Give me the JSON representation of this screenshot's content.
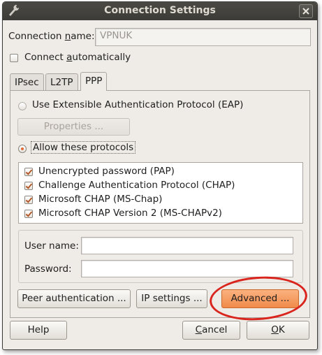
{
  "window": {
    "title": "Connection Settings"
  },
  "connection_name": {
    "label": "Connection name:",
    "value": "VPNUK"
  },
  "connect_automatically": {
    "label": "Connect automatically",
    "checked": false
  },
  "tabs": [
    {
      "label": "IPsec",
      "active": false
    },
    {
      "label": "L2TP",
      "active": false
    },
    {
      "label": "PPP",
      "active": true
    }
  ],
  "ppp": {
    "eap_option": {
      "label": "Use Extensible Authentication Protocol (EAP)",
      "selected": false
    },
    "properties_button": "Properties ...",
    "allow_option": {
      "label": "Allow these protocols",
      "selected": true
    },
    "protocols": [
      {
        "label": "Unencrypted password (PAP)",
        "checked": true
      },
      {
        "label": "Challenge Authentication Protocol (CHAP)",
        "checked": true
      },
      {
        "label": "Microsoft CHAP (MS-Chap)",
        "checked": true
      },
      {
        "label": "Microsoft CHAP Version 2 (MS-CHAPv2)",
        "checked": true
      }
    ],
    "username": {
      "label": "User name:",
      "value": ""
    },
    "password": {
      "label": "Password:",
      "value": ""
    },
    "peer_auth_button": "Peer authentication ...",
    "ip_settings_button": "IP settings ...",
    "advanced_button": "Advanced ..."
  },
  "footer": {
    "help": "Help",
    "cancel": "Cancel",
    "ok": "OK"
  },
  "colors": {
    "accent": "#f08a4b",
    "annotation": "#d9251d",
    "titlebar": "#3c3b37"
  }
}
